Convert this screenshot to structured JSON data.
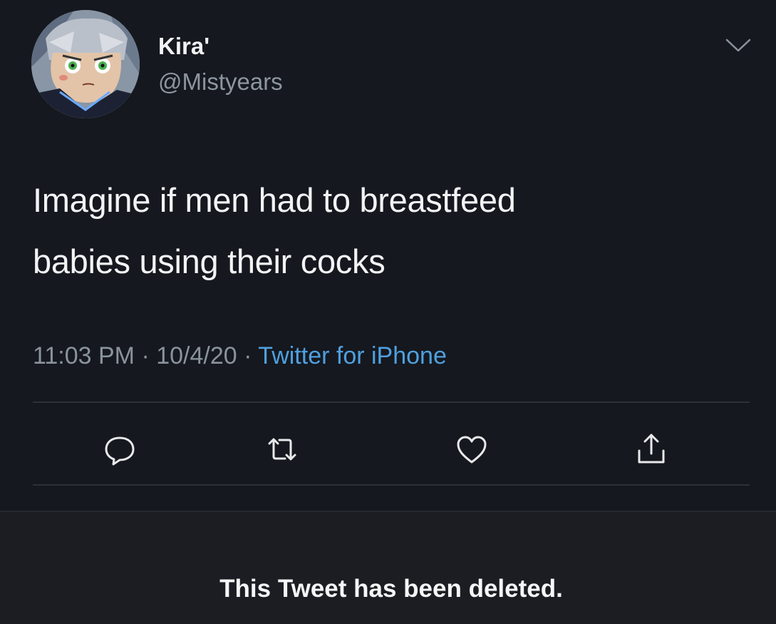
{
  "author": {
    "display_name": "Kira'",
    "handle": "@Mistyears"
  },
  "tweet": {
    "text_line1": "Imagine if men had to breastfeed",
    "text_line2": "babies using their cocks"
  },
  "meta": {
    "time": "11:03 PM",
    "separator1": " · ",
    "date": "10/4/20",
    "separator2": " · ",
    "source": "Twitter for iPhone"
  },
  "notice": {
    "deleted": "This Tweet has been deleted."
  },
  "colors": {
    "background": "#15181e",
    "link": "#4fa0e0",
    "secondary_text": "#8a939c"
  },
  "icons": [
    "chevron-down-icon",
    "reply-icon",
    "retweet-icon",
    "like-icon",
    "share-icon"
  ]
}
